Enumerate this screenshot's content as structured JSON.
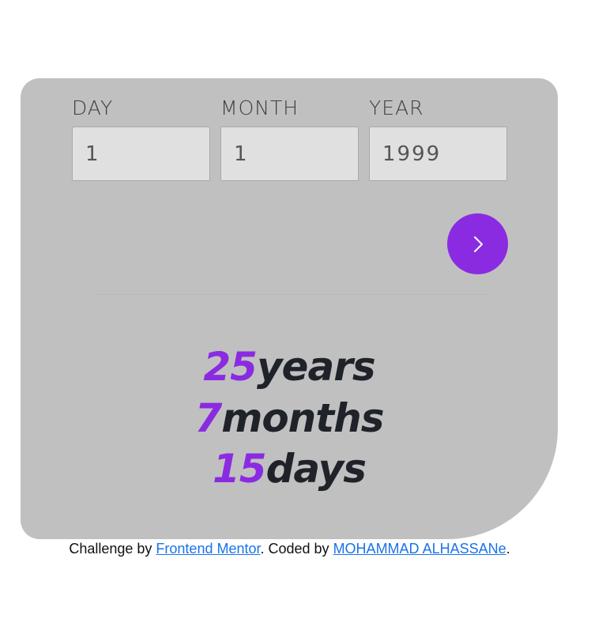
{
  "form": {
    "day": {
      "label": "DAY",
      "value": "1"
    },
    "month": {
      "label": "MONTH",
      "value": "1"
    },
    "year": {
      "label": "YEAR",
      "value": "1999"
    },
    "submit_icon": "chevron-right-icon"
  },
  "result": {
    "years_value": "25",
    "years_unit": "years",
    "months_value": "7",
    "months_unit": "months",
    "days_value": "15",
    "days_unit": "days"
  },
  "attribution": {
    "prefix": "Challenge by ",
    "link1": "Frontend Mentor",
    "middle": ". Coded by ",
    "link2": "MOHAMMAD ALHASSANe",
    "suffix": "."
  },
  "colors": {
    "card_bg": "#c0c0c0",
    "accent": "#8a2be2",
    "input_bg": "#e0e0e0",
    "unit_text": "#1f2329",
    "link": "#1a73e8"
  }
}
